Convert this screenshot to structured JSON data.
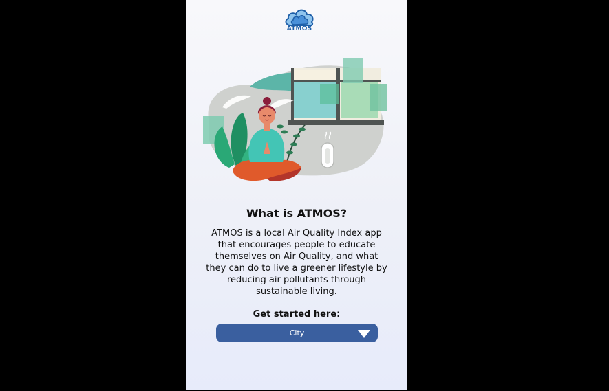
{
  "app": {
    "logo_text": "ATMOS"
  },
  "intro": {
    "title": "What is ATMOS?",
    "description": "ATMOS is a local Air Quality Index app that encourages people to educate themselves on Air Quality, and what they can do to live a greener lifestyle by reducing air pollutants through sustainable living.",
    "cta_label": "Get started here:"
  },
  "city_select": {
    "selected": "City",
    "icon": "chevron-down-icon"
  },
  "colors": {
    "accent": "#3a5f9f",
    "logo": "#1f5fa8",
    "background": "#000000"
  }
}
